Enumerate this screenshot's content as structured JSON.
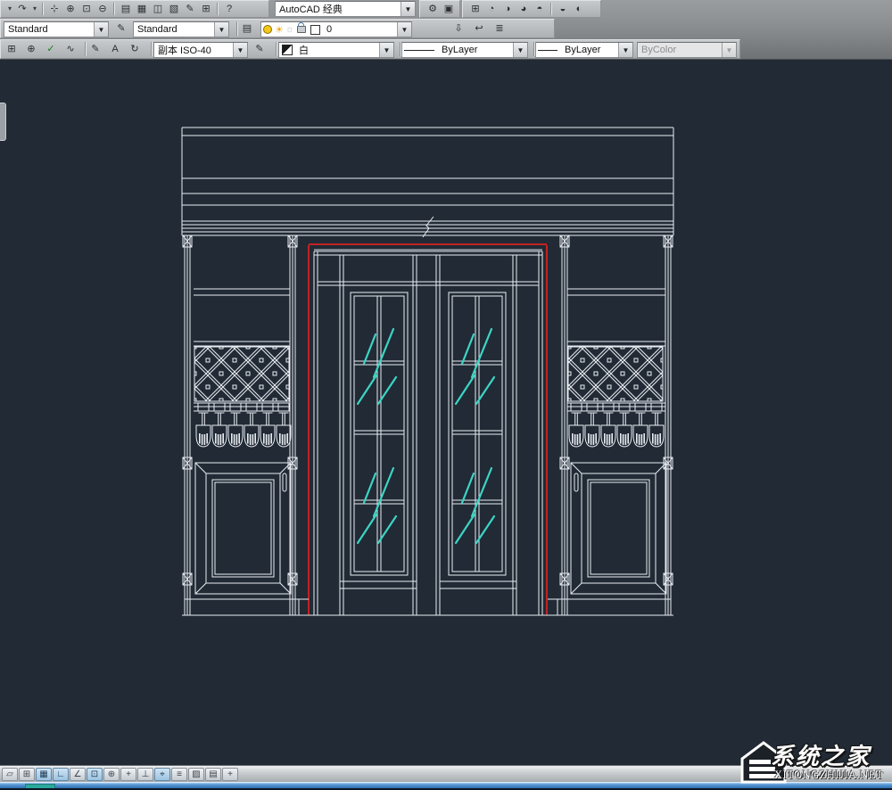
{
  "theme": {
    "dock_top": "#9a9da0",
    "dock_bottom": "#6f7275",
    "canvas_bg": "#212a35",
    "line": "#e9edf2",
    "red": "#c32222",
    "cyan": "#3cd5c5",
    "gray_band": "#8e959d"
  },
  "toolbars": {
    "row1": {
      "left_icons": [
        {
          "name": "undo-dropdown-arrow-icon",
          "glyph": "▾"
        },
        {
          "name": "redo-icon",
          "glyph": "↷"
        },
        {
          "name": "redo-dropdown-arrow-icon",
          "glyph": "▾"
        },
        {
          "name": "pan-icon",
          "glyph": "⊹"
        },
        {
          "name": "zoom-realtime-icon",
          "glyph": "⊕"
        },
        {
          "name": "zoom-window-icon",
          "glyph": "⊡"
        },
        {
          "name": "zoom-previous-icon",
          "glyph": "⊖"
        },
        {
          "name": "properties-palette-icon",
          "glyph": "▤"
        },
        {
          "name": "designcenter-icon",
          "glyph": "▦"
        },
        {
          "name": "tool-palettes-icon",
          "glyph": "◫"
        },
        {
          "name": "sheet-set-manager-icon",
          "glyph": "▧"
        },
        {
          "name": "markup-set-manager-icon",
          "glyph": "✎"
        },
        {
          "name": "quickcalc-icon",
          "glyph": "⊞"
        },
        {
          "name": "help-icon",
          "glyph": "?"
        }
      ],
      "workspace": {
        "value": "AutoCAD 经典"
      },
      "right_icons": [
        {
          "name": "workspace-settings-gear-icon",
          "glyph": "⚙"
        },
        {
          "name": "workspace-save-icon",
          "glyph": "▣"
        },
        {
          "name": "viewports-icon",
          "glyph": "⊞"
        },
        {
          "name": "view-top-icon",
          "glyph": "◔"
        },
        {
          "name": "view-front-icon",
          "glyph": "◑"
        },
        {
          "name": "view-side-icon",
          "glyph": "◕"
        },
        {
          "name": "view-iso-icon",
          "glyph": "◓"
        },
        {
          "name": "ucs-world-icon",
          "glyph": "◒"
        },
        {
          "name": "ucs-previous-icon",
          "glyph": "◐"
        }
      ]
    },
    "row2": {
      "style_value": "Standard",
      "apply_style_icon": {
        "name": "apply-style-icon",
        "glyph": "✎"
      },
      "style2_value": "Standard",
      "layer_manager_icon": {
        "name": "layer-properties-manager-icon",
        "glyph": "▤"
      },
      "layer": {
        "current": "0"
      },
      "right_icons": [
        {
          "name": "make-object-layer-current-icon",
          "glyph": "⇩"
        },
        {
          "name": "layer-previous-icon",
          "glyph": "↩"
        },
        {
          "name": "layer-states-icon",
          "glyph": "≣"
        }
      ]
    },
    "row3": {
      "left_icons": [
        {
          "name": "table-style-icon",
          "glyph": "⊞"
        },
        {
          "name": "point-style-icon",
          "glyph": "⊕"
        },
        {
          "name": "quick-dimension-icon",
          "glyph": "✓"
        },
        {
          "name": "revision-cloud-icon",
          "glyph": "∿"
        },
        {
          "name": "edit-dimension-icon",
          "glyph": "✎"
        },
        {
          "name": "text-style-icon",
          "glyph": "A"
        },
        {
          "name": "dimension-update-icon",
          "glyph": "↻"
        }
      ],
      "dim_style_value": "副本 ISO-40",
      "match_icon": {
        "name": "match-properties-icon",
        "glyph": "✎"
      },
      "color_value": "白",
      "linetype_value": "ByLayer",
      "lineweight_value": "ByLayer",
      "plotstyle_value": "ByColor"
    }
  },
  "statusbar": {
    "buttons": [
      {
        "name": "infer-constraints",
        "glyph": "▱",
        "pressed": false
      },
      {
        "name": "snap-mode",
        "glyph": "⊞",
        "pressed": false
      },
      {
        "name": "grid-display",
        "glyph": "▦",
        "pressed": true
      },
      {
        "name": "ortho-mode",
        "glyph": "∟",
        "pressed": true
      },
      {
        "name": "polar-tracking",
        "glyph": "∠",
        "pressed": false
      },
      {
        "name": "object-snap",
        "glyph": "⊡",
        "pressed": true
      },
      {
        "name": "object-snap-3d",
        "glyph": "⊕",
        "pressed": false
      },
      {
        "name": "object-snap-tracking",
        "glyph": "+",
        "pressed": false
      },
      {
        "name": "dynamic-ucs",
        "glyph": "⊥",
        "pressed": false
      },
      {
        "name": "dynamic-input",
        "glyph": "⌖",
        "pressed": true
      },
      {
        "name": "lineweight-display",
        "glyph": "≡",
        "pressed": false
      },
      {
        "name": "transparency-display",
        "glyph": "▨",
        "pressed": false
      },
      {
        "name": "quick-properties",
        "glyph": "▤",
        "pressed": false
      },
      {
        "name": "selection-cycling",
        "glyph": "+",
        "pressed": false
      }
    ]
  },
  "watermark": {
    "title": "系统之家",
    "site": "XITONGZHIJIA.NET"
  }
}
